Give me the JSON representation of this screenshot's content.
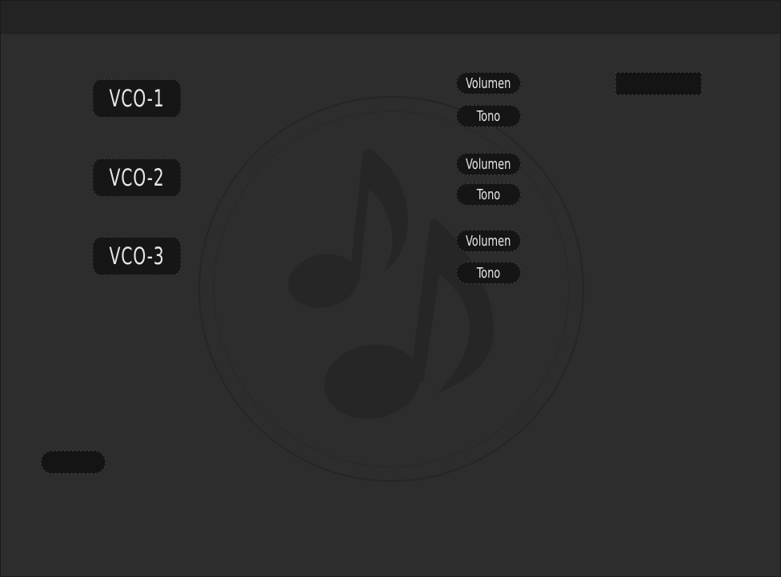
{
  "vco_buttons": [
    {
      "label": "VCO-1"
    },
    {
      "label": "VCO-2"
    },
    {
      "label": "VCO-3"
    }
  ],
  "controls": [
    {
      "volume_label": "Volumen",
      "tone_label": "Tono"
    },
    {
      "volume_label": "Volumen",
      "tone_label": "Tono"
    },
    {
      "volume_label": "Volumen",
      "tone_label": "Tono"
    }
  ],
  "background_icon": "music-note-icon",
  "colors": {
    "background": "#2d2d2d",
    "titlebar": "#232323",
    "button": "#161616",
    "text": "#e6e6e6"
  }
}
